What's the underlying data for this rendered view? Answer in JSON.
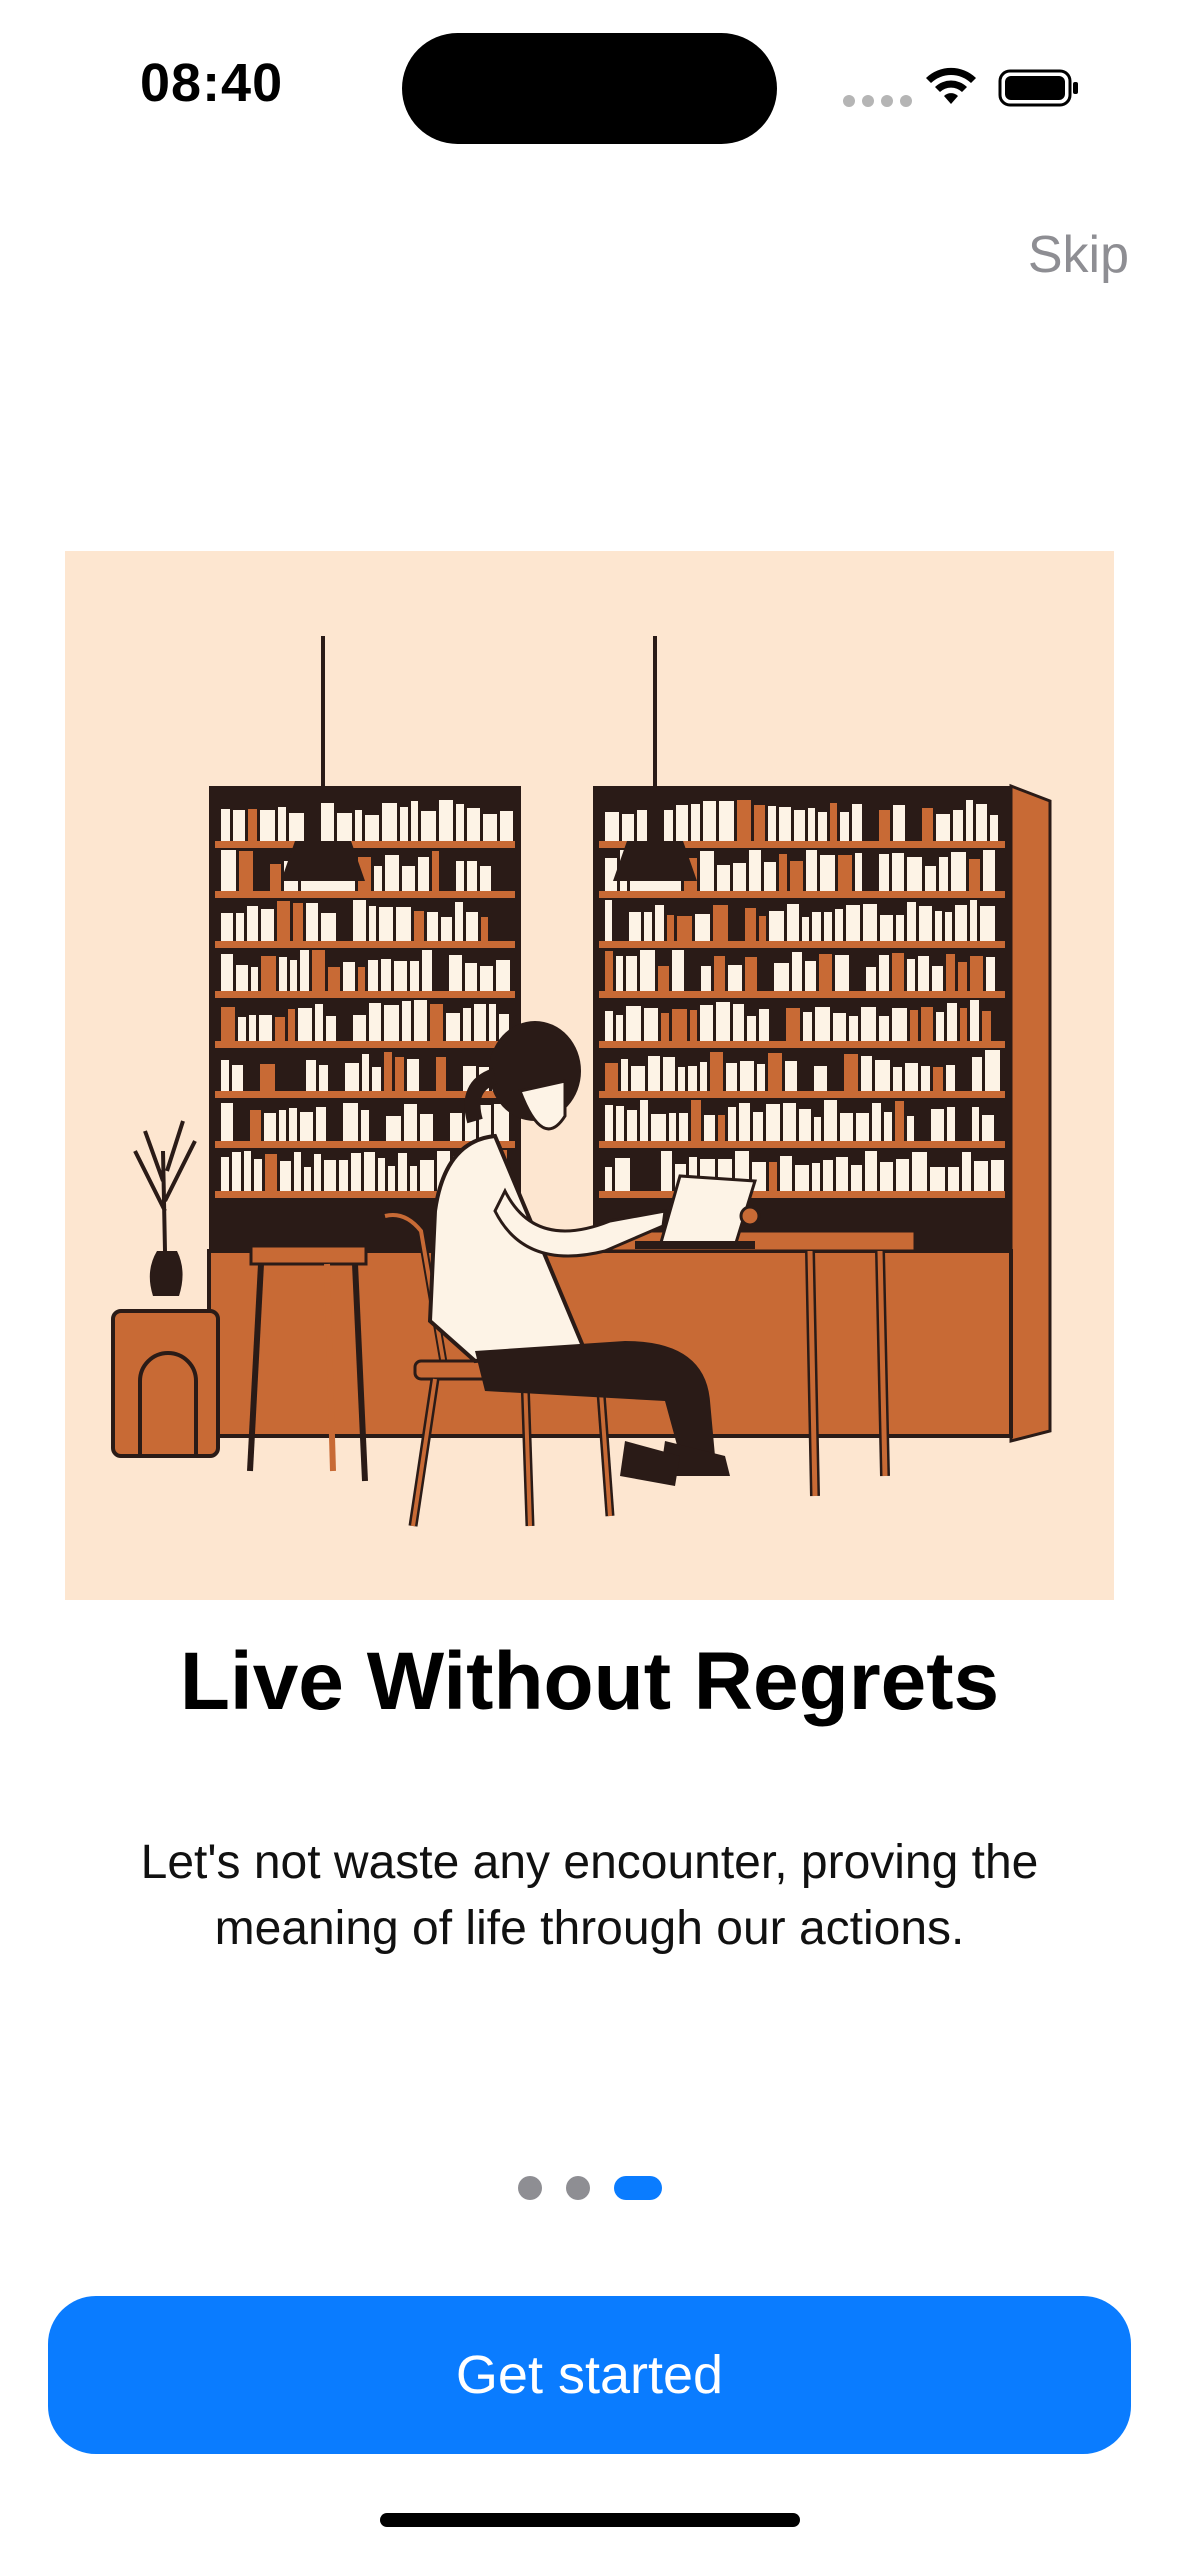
{
  "status_bar": {
    "time": "08:40"
  },
  "onboarding": {
    "skip_label": "Skip",
    "title": "Live Without Regrets",
    "subtitle": "Let's not waste any encounter, proving the meaning of life through our actions.",
    "page_count": 3,
    "current_page": 3,
    "cta_label": "Get started"
  },
  "colors": {
    "accent": "#0a7cff",
    "illustration_bg": "#fde6d0",
    "shelf_brown": "#c86a35",
    "ink": "#2a1b17",
    "inactive_dot": "#8e8e93"
  },
  "icons": [
    "wifi-icon",
    "battery-icon",
    "signal-icon"
  ]
}
